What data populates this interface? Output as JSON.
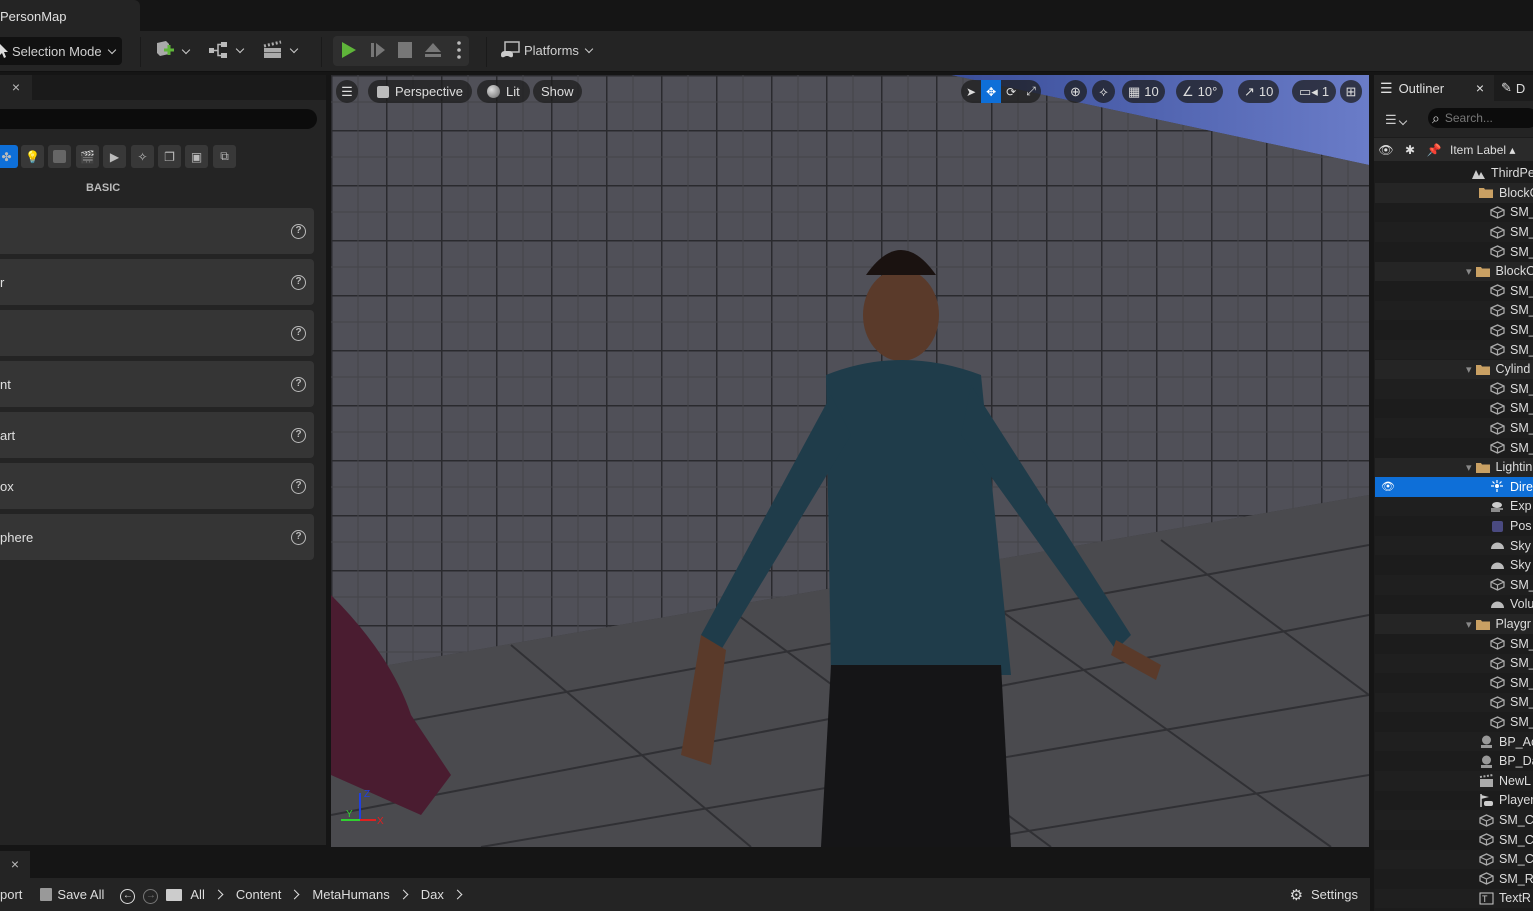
{
  "window": {
    "map_tab_title": "PersonMap"
  },
  "toolbar": {
    "selection_mode": "Selection Mode",
    "add_icon": "add-actor-icon",
    "blueprint_icon": "blueprint-icon",
    "cinematics_icon": "clapperboard-icon",
    "play_icon": "play-icon",
    "step_icon": "step-icon",
    "stop_icon": "stop-icon",
    "eject_icon": "eject-icon",
    "more_icon": "more-vertical-icon",
    "platforms": "Platforms"
  },
  "place_actors": {
    "close": "×",
    "category_label": "BASIC",
    "categories": [
      "basic",
      "lights",
      "shapes",
      "cinematic",
      "visual-effects",
      "volumes",
      "geometry",
      "all-classes",
      "recent"
    ],
    "items": [
      {
        "label": ""
      },
      {
        "label": "r"
      },
      {
        "label": ""
      },
      {
        "label": "nt"
      },
      {
        "label": "art"
      },
      {
        "label": "ox"
      },
      {
        "label": "phere"
      }
    ],
    "help_glyph": "?"
  },
  "viewport": {
    "menu_icon": "hamburger-icon",
    "perspective": "Perspective",
    "lit": "Lit",
    "show": "Show",
    "grid_snap": "10",
    "rotation_snap": "10°",
    "scale_snap": "10",
    "camera_speed": "1",
    "axis": {
      "z": "Z",
      "y": "Y",
      "x": "X"
    }
  },
  "outliner": {
    "tab_label": "Outliner",
    "close": "×",
    "second_tab_label": "D",
    "search_placeholder": "Search...",
    "column_label": "Item Label",
    "rows": [
      {
        "label": "ThirdPe",
        "icon": "level-icon",
        "indent": 0,
        "type": "level"
      },
      {
        "label": "BlockO",
        "icon": "folder-icon",
        "indent": 1,
        "type": "folder"
      },
      {
        "label": "SM_",
        "icon": "static-mesh-icon",
        "indent": 2,
        "type": "mesh"
      },
      {
        "label": "SM_",
        "icon": "static-mesh-icon",
        "indent": 2,
        "type": "mesh"
      },
      {
        "label": "SM_",
        "icon": "static-mesh-icon",
        "indent": 2,
        "type": "mesh"
      },
      {
        "label": "BlockO",
        "icon": "folder-icon",
        "indent": 1,
        "type": "folder",
        "expanded": true
      },
      {
        "label": "SM_",
        "icon": "static-mesh-icon",
        "indent": 2,
        "type": "mesh"
      },
      {
        "label": "SM_",
        "icon": "static-mesh-icon",
        "indent": 2,
        "type": "mesh"
      },
      {
        "label": "SM_",
        "icon": "static-mesh-icon",
        "indent": 2,
        "type": "mesh"
      },
      {
        "label": "SM_",
        "icon": "static-mesh-icon",
        "indent": 2,
        "type": "mesh"
      },
      {
        "label": "Cylind",
        "icon": "folder-icon",
        "indent": 1,
        "type": "folder",
        "expanded": true
      },
      {
        "label": "SM_",
        "icon": "static-mesh-icon",
        "indent": 2,
        "type": "mesh"
      },
      {
        "label": "SM_",
        "icon": "static-mesh-icon",
        "indent": 2,
        "type": "mesh"
      },
      {
        "label": "SM_",
        "icon": "static-mesh-icon",
        "indent": 2,
        "type": "mesh"
      },
      {
        "label": "SM_",
        "icon": "static-mesh-icon",
        "indent": 2,
        "type": "mesh"
      },
      {
        "label": "Lightin",
        "icon": "folder-icon",
        "indent": 1,
        "type": "folder",
        "expanded": true
      },
      {
        "label": "Dire",
        "icon": "directional-light-icon",
        "indent": 2,
        "type": "light",
        "selected": true
      },
      {
        "label": "Exp",
        "icon": "exponential-fog-icon",
        "indent": 2,
        "type": "fog"
      },
      {
        "label": "Pos",
        "icon": "post-process-icon",
        "indent": 2,
        "type": "volume"
      },
      {
        "label": "Sky",
        "icon": "sky-atmosphere-icon",
        "indent": 2,
        "type": "sky"
      },
      {
        "label": "Sky",
        "icon": "sky-light-icon",
        "indent": 2,
        "type": "sky"
      },
      {
        "label": "SM_",
        "icon": "static-mesh-icon",
        "indent": 2,
        "type": "mesh"
      },
      {
        "label": "Volu",
        "icon": "volumetric-cloud-icon",
        "indent": 2,
        "type": "sky"
      },
      {
        "label": "Playgr",
        "icon": "folder-icon",
        "indent": 1,
        "type": "folder",
        "expanded": true
      },
      {
        "label": "SM_",
        "icon": "static-mesh-icon",
        "indent": 2,
        "type": "mesh"
      },
      {
        "label": "SM_",
        "icon": "static-mesh-icon",
        "indent": 2,
        "type": "mesh"
      },
      {
        "label": "SM_",
        "icon": "static-mesh-icon",
        "indent": 2,
        "type": "mesh"
      },
      {
        "label": "SM_",
        "icon": "static-mesh-icon",
        "indent": 2,
        "type": "mesh"
      },
      {
        "label": "SM_",
        "icon": "static-mesh-icon",
        "indent": 2,
        "type": "mesh"
      },
      {
        "label": "BP_Ac",
        "icon": "blueprint-actor-icon",
        "indent": 1,
        "type": "bp"
      },
      {
        "label": "BP_Da",
        "icon": "blueprint-actor-icon",
        "indent": 1,
        "type": "bp"
      },
      {
        "label": "NewL",
        "icon": "level-sequence-icon",
        "indent": 1,
        "type": "seq"
      },
      {
        "label": "Player",
        "icon": "player-start-icon",
        "indent": 1,
        "type": "player"
      },
      {
        "label": "SM_C",
        "icon": "static-mesh-icon",
        "indent": 1,
        "type": "mesh"
      },
      {
        "label": "SM_C",
        "icon": "static-mesh-icon",
        "indent": 1,
        "type": "mesh"
      },
      {
        "label": "SM_C",
        "icon": "static-mesh-icon",
        "indent": 1,
        "type": "mesh"
      },
      {
        "label": "SM_R",
        "icon": "static-mesh-icon",
        "indent": 1,
        "type": "mesh"
      },
      {
        "label": "TextR",
        "icon": "text-render-icon",
        "indent": 1,
        "type": "text"
      }
    ]
  },
  "content_browser": {
    "close": "×",
    "import": "port",
    "save_all": "Save All",
    "breadcrumbs": [
      "All",
      "Content",
      "MetaHumans",
      "Dax"
    ],
    "settings": "Settings"
  },
  "colors": {
    "accent": "#0e6fd8",
    "play_green": "#5fb53a",
    "folder": "#c9a063",
    "bg_panel": "#242424"
  }
}
